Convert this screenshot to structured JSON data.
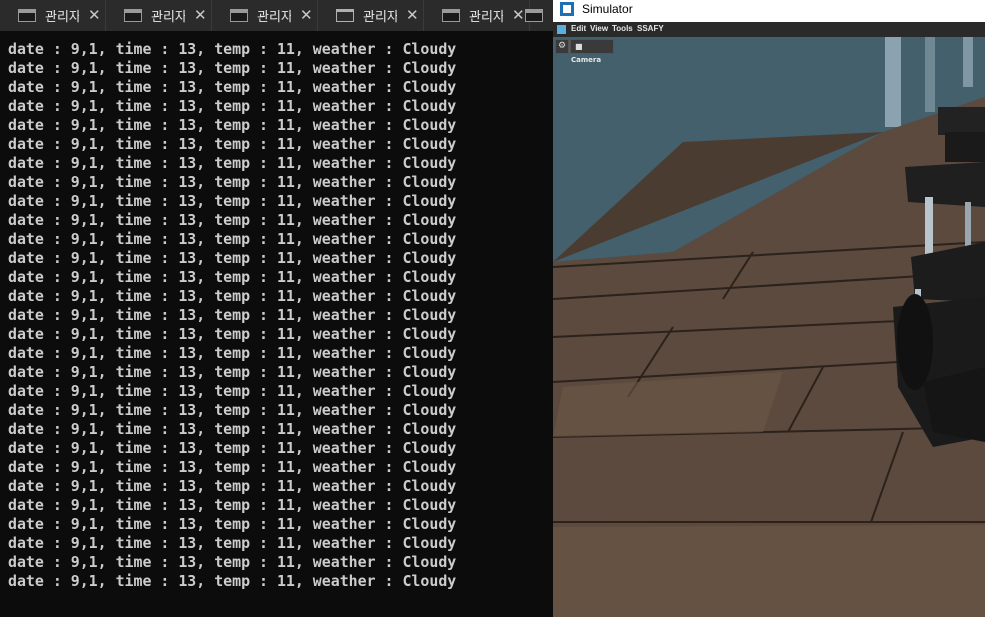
{
  "terminal": {
    "tabs": [
      {
        "label": "관리자",
        "icon": "cmd-icon"
      },
      {
        "label": "관리자",
        "icon": "cmd-icon"
      },
      {
        "label": "관리자",
        "icon": "cmd-icon"
      },
      {
        "label": "관리자",
        "icon": "terminal-window-icon"
      },
      {
        "label": "관리자",
        "icon": "cmd-icon"
      },
      {
        "label": "",
        "icon": "cmd-icon"
      }
    ],
    "close_glyph": "✕",
    "lines": [
      "date : 9,1, time : 13, temp : 11, weather : Cloudy",
      "date : 9,1, time : 13, temp : 11, weather : Cloudy",
      "date : 9,1, time : 13, temp : 11, weather : Cloudy",
      "date : 9,1, time : 13, temp : 11, weather : Cloudy",
      "date : 9,1, time : 13, temp : 11, weather : Cloudy",
      "date : 9,1, time : 13, temp : 11, weather : Cloudy",
      "date : 9,1, time : 13, temp : 11, weather : Cloudy",
      "date : 9,1, time : 13, temp : 11, weather : Cloudy",
      "date : 9,1, time : 13, temp : 11, weather : Cloudy",
      "date : 9,1, time : 13, temp : 11, weather : Cloudy",
      "date : 9,1, time : 13, temp : 11, weather : Cloudy",
      "date : 9,1, time : 13, temp : 11, weather : Cloudy",
      "date : 9,1, time : 13, temp : 11, weather : Cloudy",
      "date : 9,1, time : 13, temp : 11, weather : Cloudy",
      "date : 9,1, time : 13, temp : 11, weather : Cloudy",
      "date : 9,1, time : 13, temp : 11, weather : Cloudy",
      "date : 9,1, time : 13, temp : 11, weather : Cloudy",
      "date : 9,1, time : 13, temp : 11, weather : Cloudy",
      "date : 9,1, time : 13, temp : 11, weather : Cloudy",
      "date : 9,1, time : 13, temp : 11, weather : Cloudy",
      "date : 9,1, time : 13, temp : 11, weather : Cloudy",
      "date : 9,1, time : 13, temp : 11, weather : Cloudy",
      "date : 9,1, time : 13, temp : 11, weather : Cloudy",
      "date : 9,1, time : 13, temp : 11, weather : Cloudy",
      "date : 9,1, time : 13, temp : 11, weather : Cloudy",
      "date : 9,1, time : 13, temp : 11, weather : Cloudy",
      "date : 9,1, time : 13, temp : 11, weather : Cloudy",
      "date : 9,1, time : 13, temp : 11, weather : Cloudy",
      "date : 9,1, time : 13, temp : 11, weather : Cloudy"
    ],
    "colors": {
      "background": "#0c0c0c",
      "text": "#cccccc",
      "tabbar": "#2b2b2b"
    }
  },
  "simulator": {
    "title": "Simulator",
    "menu": [
      "Edit",
      "View",
      "Tools",
      "SSAFY"
    ],
    "toolbar": {
      "settings_icon": "gear-icon",
      "camera_label": "Camera",
      "camera_icon": "camera-icon"
    },
    "colors": {
      "wall": "#3d5560",
      "floor": "#5d4a3c",
      "robot": "#1e1e1e"
    }
  }
}
